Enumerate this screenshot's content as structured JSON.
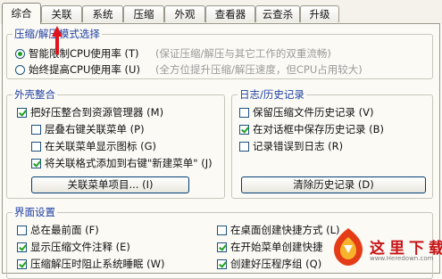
{
  "tabs": [
    "综合",
    "关联",
    "系统",
    "压缩",
    "外观",
    "查看器",
    "云查杀",
    "升级"
  ],
  "active_tab": "综合",
  "mode_group": {
    "title": "压缩/解压模式选择",
    "options": [
      {
        "label": "智能限制CPU使用率 (T)",
        "hint": "(保证压缩/解压与其它工作的双重流畅)",
        "selected": true
      },
      {
        "label": "始终提高CPU使用率 (U)",
        "hint": "(全方位提升压缩/解压速度，但CPU占用较大)",
        "selected": false
      }
    ]
  },
  "shell_group": {
    "title": "外壳整合",
    "items": [
      {
        "label": "把好压整合到资源管理器 (M)",
        "checked": true
      },
      {
        "label": "层叠右键关联菜单 (P)",
        "checked": false
      },
      {
        "label": "在关联菜单显示图标 (G)",
        "checked": false
      },
      {
        "label": "将关联格式添加到右键\"新建菜单\" (J)",
        "checked": true
      }
    ],
    "button": "关联菜单项目... (I)"
  },
  "history_group": {
    "title": "日志/历史记录",
    "items": [
      {
        "label": "保留压缩文件历史记录 (V)",
        "checked": false
      },
      {
        "label": "在对话框中保存历史记录 (B)",
        "checked": true
      },
      {
        "label": "记录错误到日志 (R)",
        "checked": false
      }
    ],
    "button": "清除历史记录 (D)"
  },
  "ui_group": {
    "title": "界面设置",
    "left": [
      {
        "label": "总在最前面 (F)",
        "checked": false
      },
      {
        "label": "显示压缩文件注释 (E)",
        "checked": true
      },
      {
        "label": "压缩解压时阻止系统睡眠 (W)",
        "checked": true
      }
    ],
    "right": [
      {
        "label": "在桌面创建快捷方式 (L)",
        "checked": false
      },
      {
        "label": "在开始菜单创建快捷",
        "checked": true
      },
      {
        "label": "创建好压程序组 (Q)",
        "checked": true
      }
    ]
  },
  "watermark": {
    "text": "这里下载",
    "url": "www.Heredown.com"
  },
  "colors": {
    "group_title": "#1f3fa3",
    "check_mark": "#21a121",
    "arrow": "#e0141b",
    "watermark": "#c81416"
  }
}
